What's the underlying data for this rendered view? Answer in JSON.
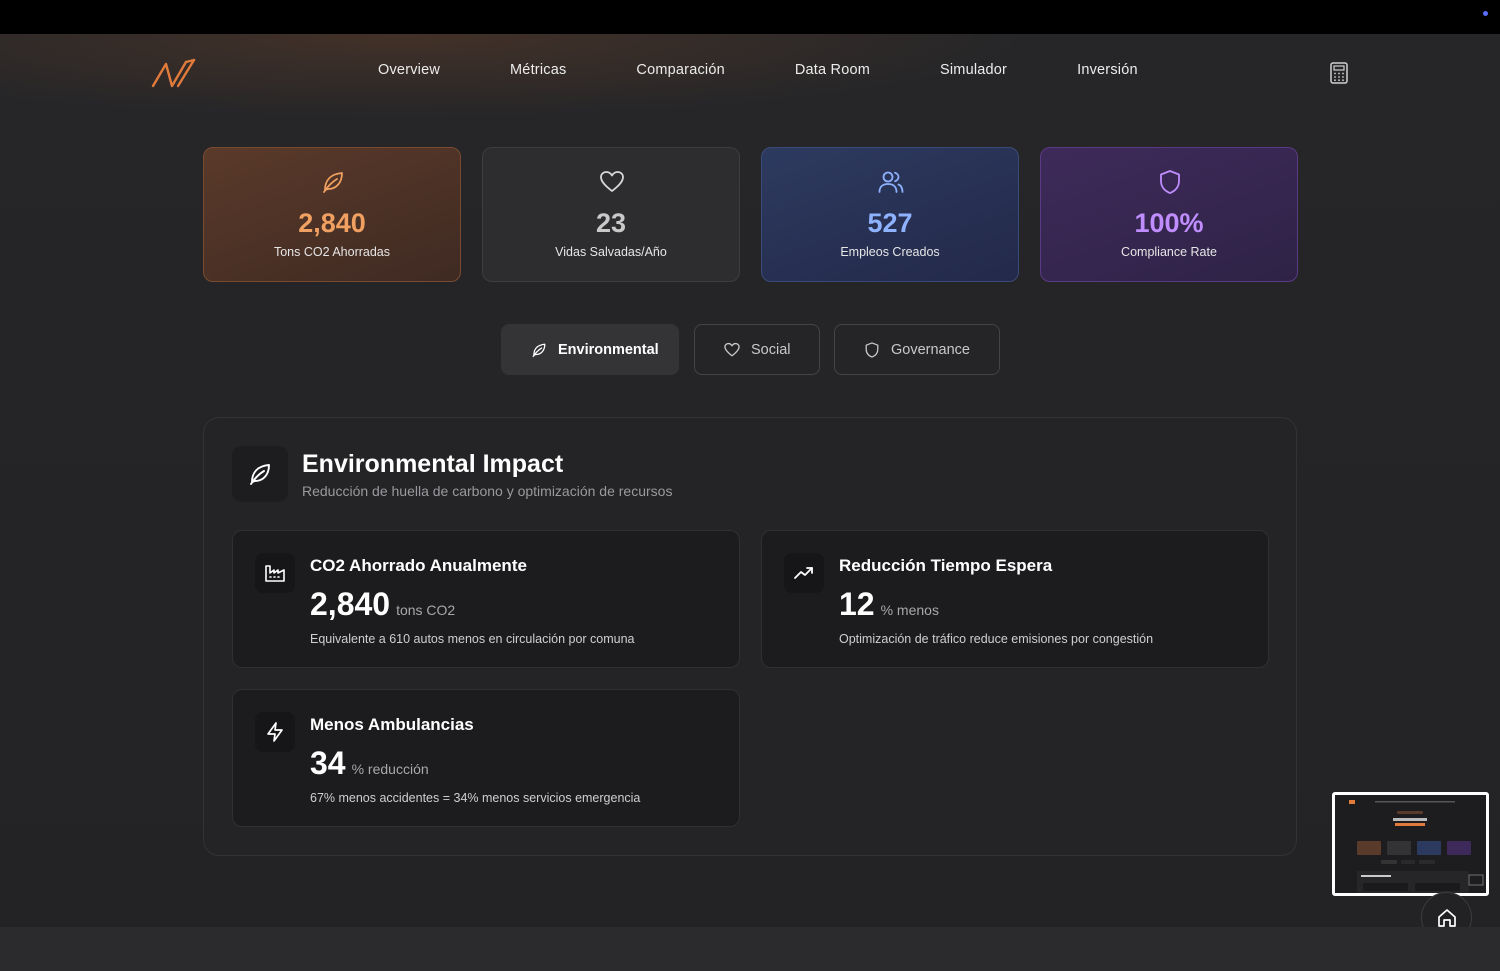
{
  "nav": {
    "items": [
      "Overview",
      "Métricas",
      "Comparación",
      "Data Room",
      "Simulador",
      "Inversión"
    ]
  },
  "kpis": [
    {
      "value": "2,840",
      "label": "Tons CO2 Ahorradas",
      "icon": "leaf-icon",
      "color": "#f0a060"
    },
    {
      "value": "23",
      "label": "Vidas Salvadas/Año",
      "icon": "heart-icon",
      "color": "#c9c9c9"
    },
    {
      "value": "527",
      "label": "Empleos Creados",
      "icon": "users-icon",
      "color": "#8fb2ff"
    },
    {
      "value": "100%",
      "label": "Compliance Rate",
      "icon": "shield-icon",
      "color": "#c08dff"
    }
  ],
  "tabs": [
    {
      "label": "Environmental",
      "icon": "leaf-icon",
      "active": true
    },
    {
      "label": "Social",
      "icon": "heart-icon",
      "active": false
    },
    {
      "label": "Governance",
      "icon": "shield-icon",
      "active": false
    }
  ],
  "panel": {
    "title": "Environmental Impact",
    "subtitle": "Reducción de huella de carbono y optimización de recursos",
    "icon": "leaf-icon",
    "metrics": [
      {
        "title": "CO2 Ahorrado Anualmente",
        "value": "2,840",
        "unit": "tons CO2",
        "description": "Equivalente a 610 autos menos en circulación por comuna",
        "icon": "factory-icon"
      },
      {
        "title": "Reducción Tiempo Espera",
        "value": "12",
        "unit": "% menos",
        "description": "Optimización de tráfico reduce emisiones por congestión",
        "icon": "trending-up-icon"
      },
      {
        "title": "Menos Ambulancias",
        "value": "34",
        "unit": "% reducción",
        "description": "67% menos accidentes = 34% menos servicios emergencia",
        "icon": "zap-icon"
      }
    ]
  },
  "colors": {
    "accent": "#e07b3c",
    "background": "#232325"
  }
}
